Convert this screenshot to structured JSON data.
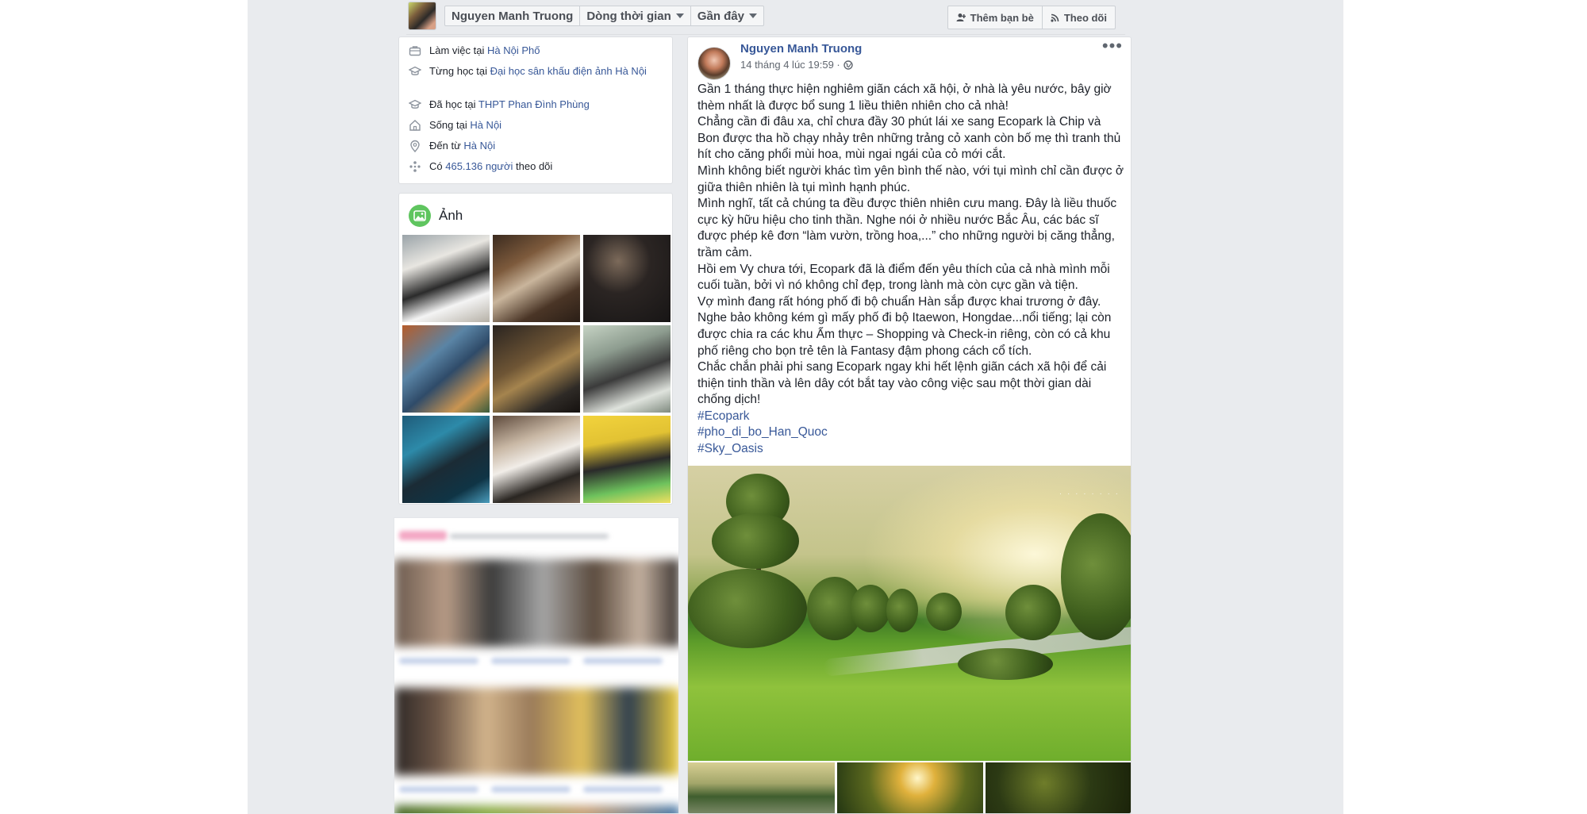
{
  "topbar": {
    "profile_name": "Nguyen Manh Truong",
    "timeline_label": "Dòng thời gian",
    "recent_label": "Gần đây",
    "add_friend_label": "Thêm bạn bè",
    "follow_label": "Theo dõi"
  },
  "intro": {
    "items": [
      {
        "prefix": "Làm việc tại ",
        "link": "Hà Nội Phố",
        "suffix": "",
        "icon": "briefcase-icon"
      },
      {
        "prefix": "Từng học tại ",
        "link": "Đại học sân khấu điện ảnh Hà Nội",
        "suffix": "",
        "icon": "graduation-cap-icon"
      },
      {
        "prefix": "Đã học tại ",
        "link": "THPT Phan Đình Phùng",
        "suffix": "",
        "icon": "graduation-cap-icon"
      },
      {
        "prefix": "Sống tại ",
        "link": "Hà Nội",
        "suffix": "",
        "icon": "home-icon"
      },
      {
        "prefix": "Đến từ ",
        "link": "Hà Nội",
        "suffix": "",
        "icon": "location-pin-icon"
      },
      {
        "prefix": "Có ",
        "link": "465.136 người",
        "suffix": " theo dõi",
        "icon": "followers-icon"
      }
    ]
  },
  "photos": {
    "title": "Ảnh"
  },
  "post": {
    "author": "Nguyen Manh Truong",
    "timestamp": "14 tháng 4 lúc 19:59 ·",
    "paragraphs": [
      "Gần 1 tháng thực hiện nghiêm giãn cách xã hội, ở nhà là yêu nước, bây giờ thèm nhất là được bổ sung 1 liều thiên nhiên cho cả nhà!",
      "Chẳng cần đi đâu xa, chỉ chưa đầy 30 phút lái xe sang Ecopark là Chip và Bon được tha hồ chạy nhảy trên những trảng cỏ xanh còn bố mẹ thì tranh thủ hít cho căng phổi mùi hoa, mùi ngai ngái của cỏ mới cắt.",
      "Mình không biết người khác tìm yên bình thế nào, với tụi mình chỉ cần được ở giữa thiên nhiên là tụi mình hạnh phúc.",
      "Mình nghĩ, tất cả chúng ta đều được thiên nhiên cưu mang. Đây là liều thuốc cực kỳ hữu hiệu cho tinh thần. Nghe nói ở nhiều nước Bắc Âu, các bác sĩ được phép kê đơn “làm vườn, trồng hoa,...” cho những người bị căng thẳng, trầm cảm.",
      "Hồi em Vy chưa tới, Ecopark đã là điểm đến yêu thích của cả nhà mình mỗi cuối tuần, bởi vì nó không chỉ đẹp, trong lành mà còn cực gần và tiện.",
      "Vợ mình đang rất hóng phố đi bộ chuẩn Hàn sắp được khai trương ở đây. Nghe bảo không kém gì mấy phố đi bộ Itaewon, Hongdae...nổi tiếng; lại còn được chia ra các khu Ẩm thực – Shopping và Check-in riêng, còn có cả khu phố riêng cho bọn trẻ tên là Fantasy đậm phong cách cổ tích.",
      "Chắc chắn phải phi sang Ecopark ngay khi hết lệnh giãn cách xã hội để cải thiện tinh thần và lên dây cót bắt tay vào công việc sau một thời gian dài chống dịch!"
    ],
    "hashtags": [
      "#Ecopark",
      "#pho_di_bo_Han_Quoc",
      "#Sky_Oasis"
    ]
  },
  "colors": {
    "link": "#385898",
    "page_bg": "#e9ebee",
    "card_border": "#dddfe2",
    "photo_icon": "#5fc55f"
  }
}
